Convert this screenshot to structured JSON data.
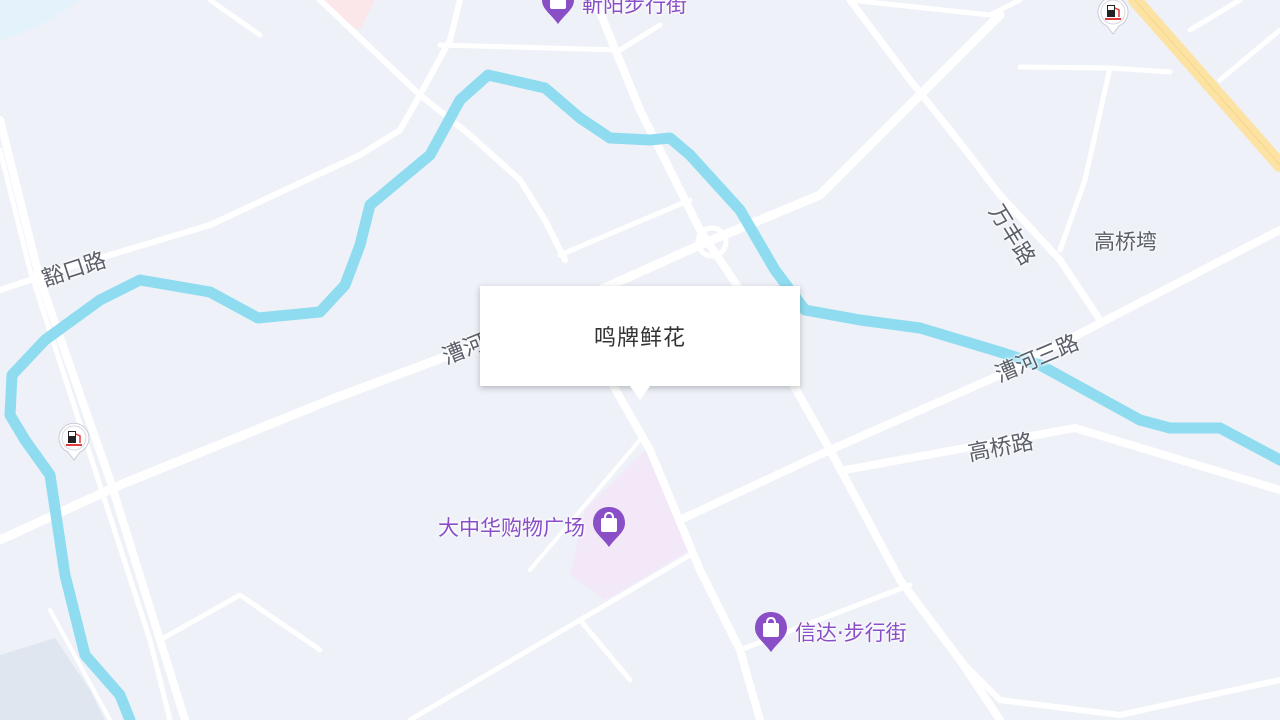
{
  "map": {
    "colors": {
      "background": "#eef1f8",
      "road": "#ffffff",
      "river": "#8fdcf1",
      "expressway": "#fde3a3",
      "poi_purple": "#8a4fc6",
      "mall_area": "#f3e8f8",
      "label_text": "#5b5f6a"
    },
    "roads": [
      {
        "name": "豁口路"
      },
      {
        "name": "漕河"
      },
      {
        "name": "万丰路"
      },
      {
        "name": "漕河三路"
      },
      {
        "name": "高桥路"
      }
    ],
    "areas": [
      {
        "name": "高桥塆"
      }
    ],
    "pois": [
      {
        "name": "靳阳步行街",
        "icon": "shopping-bag-icon"
      },
      {
        "name": "大中华购物广场",
        "icon": "shopping-bag-icon"
      },
      {
        "name": "信达·步行街",
        "icon": "shopping-bag-icon"
      }
    ],
    "stations": [
      {
        "icon": "gas-station-icon"
      },
      {
        "icon": "gas-station-icon"
      }
    ]
  },
  "popup": {
    "title": "鸣牌鲜花"
  }
}
